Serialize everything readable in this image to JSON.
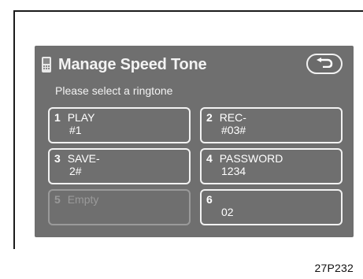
{
  "header": {
    "title": "Manage Speed Tone",
    "subtitle": "Please select a ringtone",
    "back_icon": "return-arrow-icon"
  },
  "tones": [
    {
      "num": "1",
      "name": "PLAY",
      "value": "#1",
      "enabled": true
    },
    {
      "num": "2",
      "name": "REC-",
      "value": "#03#",
      "enabled": true
    },
    {
      "num": "3",
      "name": "SAVE-",
      "value": "2#",
      "enabled": true
    },
    {
      "num": "4",
      "name": "PASSWORD",
      "value": "1234",
      "enabled": true
    },
    {
      "num": "5",
      "name": "Empty",
      "value": "",
      "enabled": false
    },
    {
      "num": "6",
      "name": "",
      "value": "02",
      "enabled": true
    }
  ],
  "footer": {
    "image_code": "27P232"
  },
  "colors": {
    "screen": "#6f6f6f",
    "text": "#ffffff",
    "disabled_text": "#9a9a9a"
  }
}
